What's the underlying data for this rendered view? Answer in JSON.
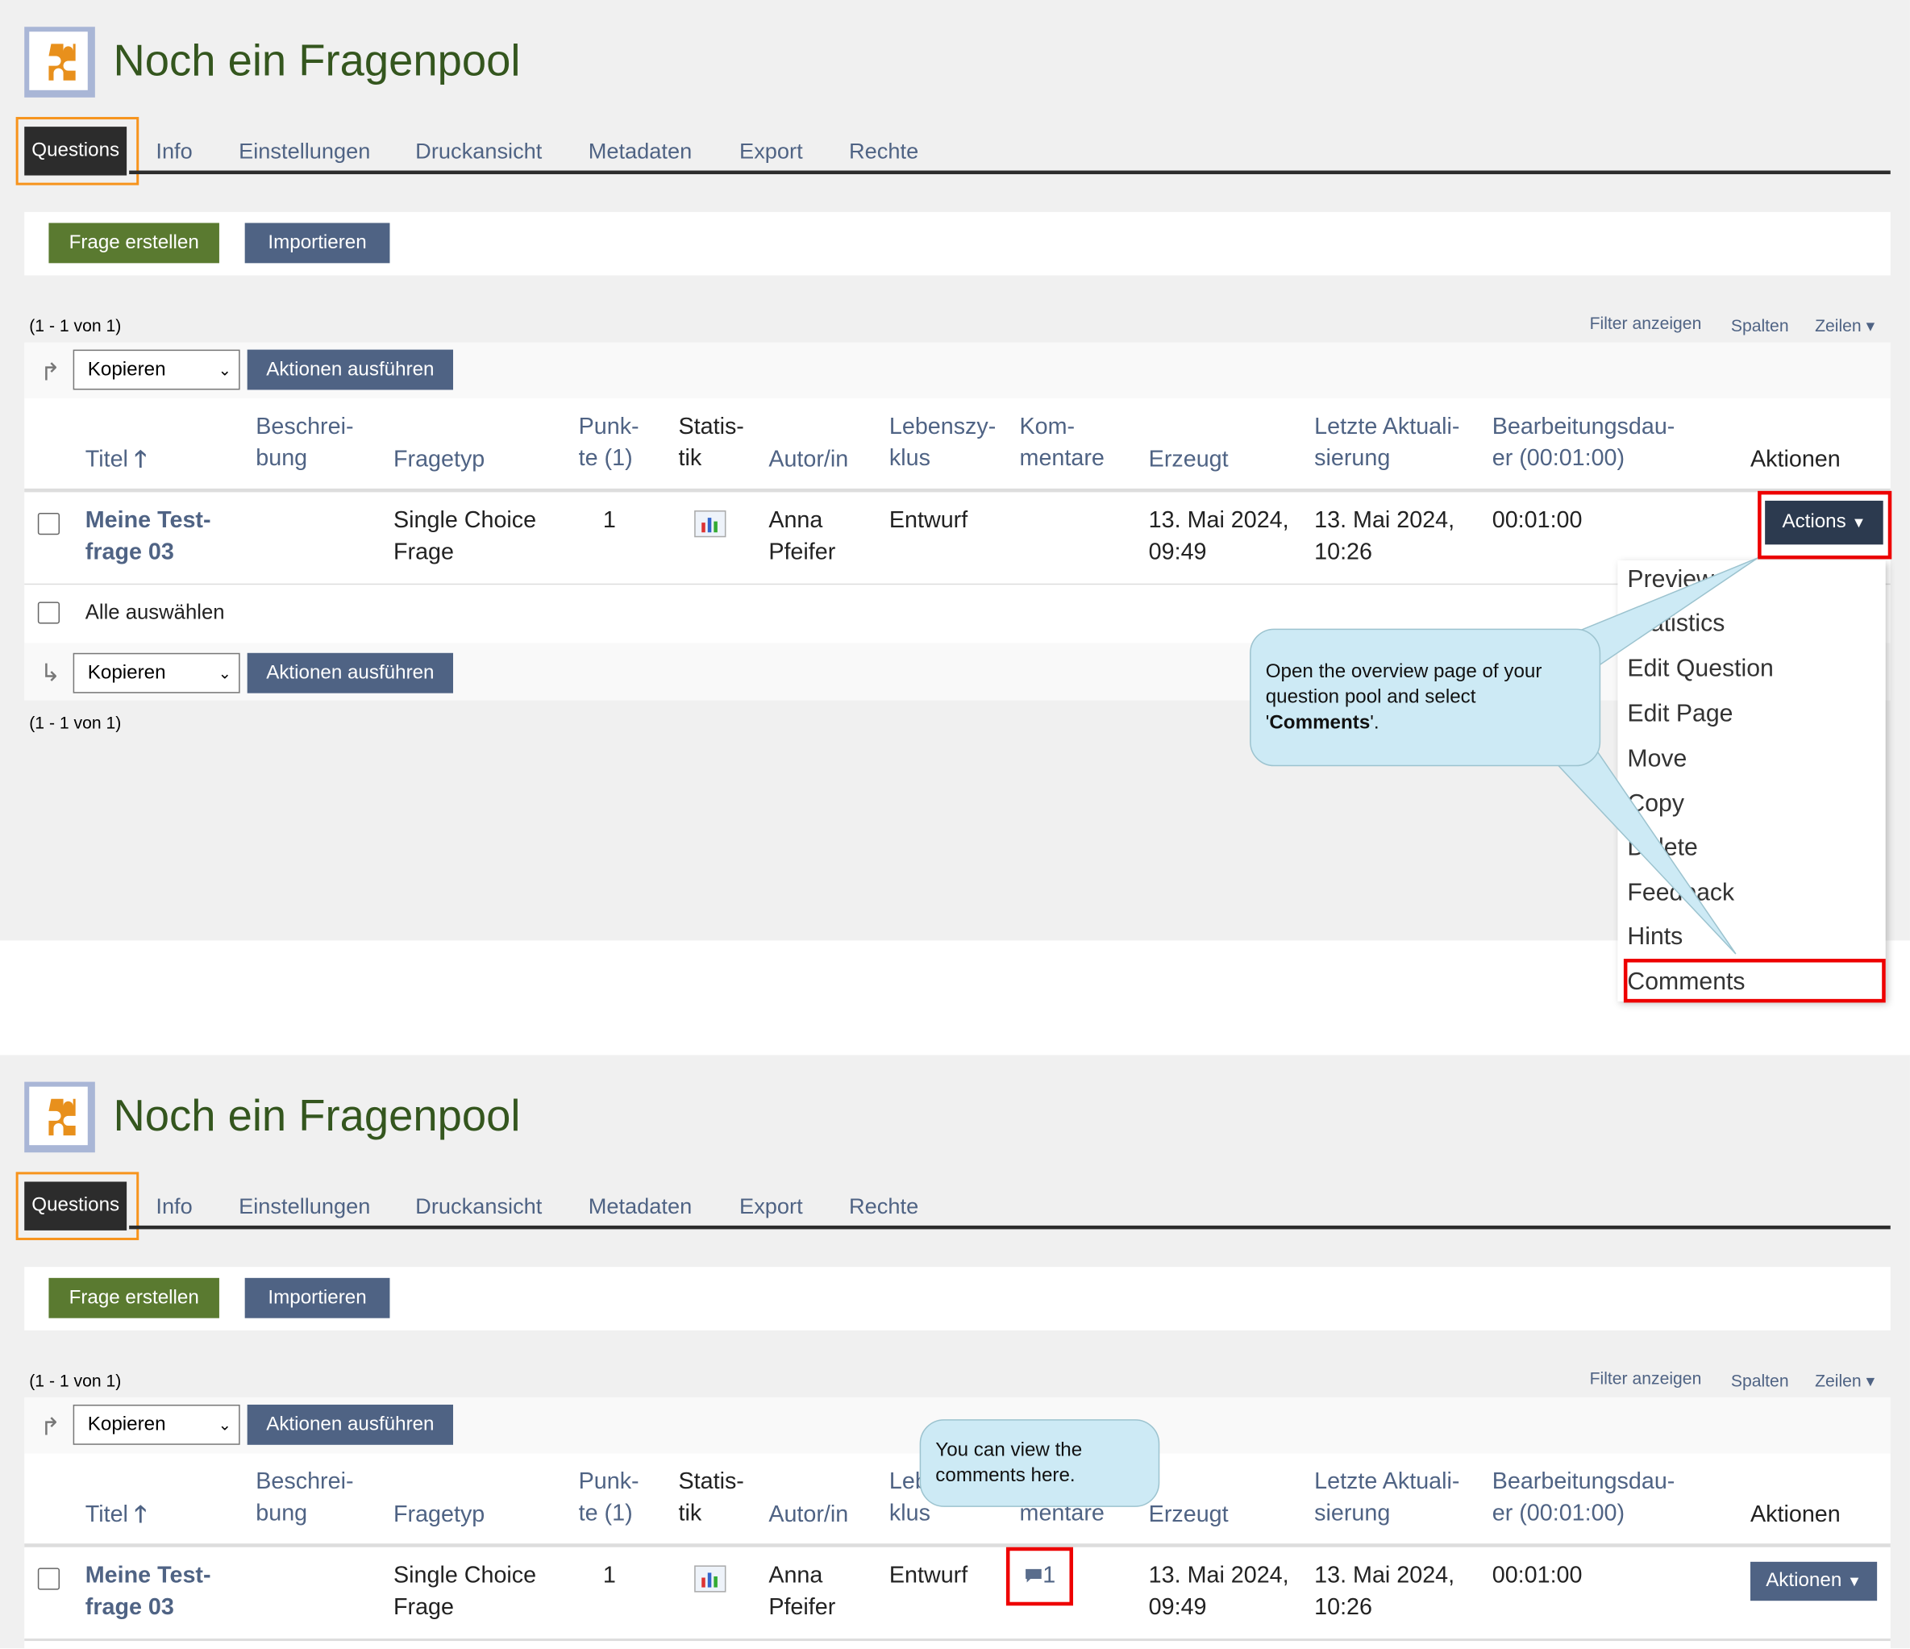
{
  "header": {
    "title": "Noch ein Fragenpool"
  },
  "tabs": [
    "Questions",
    "Info",
    "Einstellungen",
    "Druckansicht",
    "Metadaten",
    "Export",
    "Rechte"
  ],
  "toolbar": {
    "create": "Frage erstellen",
    "import": "Importieren"
  },
  "pager": "(1 - 1 von 1)",
  "table_controls": {
    "filter": "Filter anzeigen",
    "columns": "Spalten",
    "rows": "Zeilen"
  },
  "bulk": {
    "select_value": "Kopieren",
    "execute": "Aktionen ausführen"
  },
  "columns": {
    "title": "Titel",
    "desc1": "Beschrei-",
    "desc2": "bung",
    "type": "Fragetyp",
    "points1": "Punk-",
    "points2": "te (1)",
    "stats1": "Statis-",
    "stats2": "tik",
    "author": "Autor/in",
    "life1": "Lebenszy-",
    "life2": "klus",
    "comments1": "Kom-",
    "comments2": "mentare",
    "created": "Erzeugt",
    "updated1": "Letzte Aktuali-",
    "updated2": "sierung",
    "duration1": "Bearbeitungsdau-",
    "duration2": "er (00:01:00)",
    "actions": "Aktionen"
  },
  "row": {
    "title1": "Meine Test-",
    "title2": "frage 03",
    "type1": "Single Choice",
    "type2": "Frage",
    "points": "1",
    "author1": "Anna",
    "author2": "Pfeifer",
    "lifecycle": "Entwurf",
    "created1": "13. Mai 2024,",
    "created2": "09:49",
    "updated1": "13. Mai 2024,",
    "updated2": "10:26",
    "duration": "00:01:00",
    "comments_count": "1"
  },
  "select_all": "Alle auswählen",
  "panel1": {
    "actions_button": "Actions",
    "menu": [
      "Preview",
      "Statistics",
      "Edit Question",
      "Edit Page",
      "Move",
      "Copy",
      "Delete",
      "Feedback",
      "Hints",
      "Comments"
    ],
    "callout_line1": "Open the overview page of your",
    "callout_line2": "question pool and select",
    "callout_bold": "Comments"
  },
  "panel2": {
    "actions_button": "Aktionen",
    "callout_line1": "You can view the",
    "callout_line2": "comments here."
  },
  "colors": {
    "green": "#5a7a30",
    "blue": "#4f6384",
    "highlight": "#e00000",
    "tab_highlight": "#f7941d",
    "callout": "#cdeaf5"
  }
}
